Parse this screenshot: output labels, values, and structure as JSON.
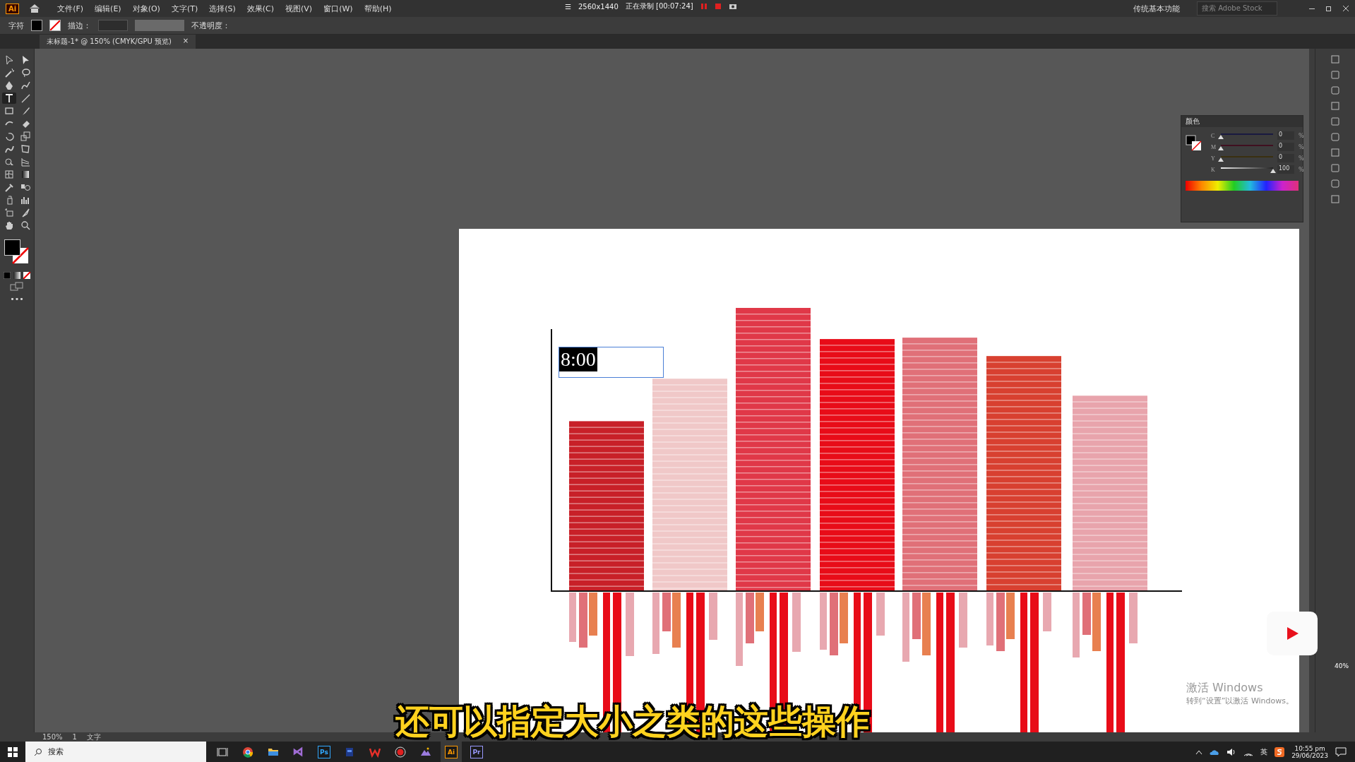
{
  "menu_bar": {
    "app_badge": "Ai",
    "items": [
      "文件(F)",
      "编辑(E)",
      "对象(O)",
      "文字(T)",
      "选择(S)",
      "效果(C)",
      "视图(V)",
      "窗口(W)",
      "帮助(H)"
    ],
    "workspace": "传统基本功能",
    "search": {
      "placeholder": "搜索 Adobe Stock"
    }
  },
  "recorder": {
    "menu": "☰",
    "resolution": "2560x1440",
    "status": "正在录制 [00:07:24]"
  },
  "control_bar": {
    "label": "字符",
    "stroke_label": "描边：",
    "opacity_label": "不透明度："
  },
  "document_tab": {
    "title": "未标题-1* @ 150% (CMYK/GPU 预览)",
    "close": "×"
  },
  "tools": [
    {
      "kind": "select",
      "selected": false
    },
    {
      "kind": "direct",
      "selected": false
    },
    {
      "kind": "wand",
      "selected": false
    },
    {
      "kind": "lasso",
      "selected": false
    },
    {
      "kind": "pen",
      "selected": false
    },
    {
      "kind": "curvature",
      "selected": false
    },
    {
      "kind": "type",
      "selected": true
    },
    {
      "kind": "line",
      "selected": false
    },
    {
      "kind": "rect",
      "selected": false
    },
    {
      "kind": "brush",
      "selected": false
    },
    {
      "kind": "shaper",
      "selected": false
    },
    {
      "kind": "eraser",
      "selected": false
    },
    {
      "kind": "rotate",
      "selected": false
    },
    {
      "kind": "scale",
      "selected": false
    },
    {
      "kind": "warp",
      "selected": false
    },
    {
      "kind": "transform",
      "selected": false
    },
    {
      "kind": "builder",
      "selected": false
    },
    {
      "kind": "perspective",
      "selected": false
    },
    {
      "kind": "mesh",
      "selected": false
    },
    {
      "kind": "gradient",
      "selected": false
    },
    {
      "kind": "eyedropper",
      "selected": false
    },
    {
      "kind": "blend",
      "selected": false
    },
    {
      "kind": "symbol",
      "selected": false
    },
    {
      "kind": "graph",
      "selected": false
    },
    {
      "kind": "artboard",
      "selected": false
    },
    {
      "kind": "slice",
      "selected": false
    },
    {
      "kind": "hand",
      "selected": false
    },
    {
      "kind": "zoom",
      "selected": false
    }
  ],
  "more_tools": "•••",
  "artboard": {
    "text_frame": {
      "text": "8:00",
      "selected": true
    },
    "bars": [
      {
        "color": "#c82028"
      },
      {
        "color": "#f0c8c8"
      },
      {
        "color": "#e03848"
      },
      {
        "color": "#e80c18"
      },
      {
        "color": "#e07078"
      },
      {
        "color": "#d84030"
      },
      {
        "color": "#e8a4ac"
      }
    ]
  },
  "color_panel": {
    "title": "颜色",
    "channels": [
      {
        "name": "C",
        "value": "0",
        "level": 0
      },
      {
        "name": "M",
        "value": "0",
        "level": 0
      },
      {
        "name": "Y",
        "value": "0",
        "level": 0
      },
      {
        "name": "K",
        "value": "100",
        "level": 1
      }
    ],
    "unit": "%"
  },
  "status_bar": {
    "zoom": "150%",
    "page": "1",
    "tool": "文字"
  },
  "taskbar": {
    "search": "搜索",
    "apps": [
      {
        "kind": "taskview",
        "selected": false
      },
      {
        "kind": "chrome",
        "selected": false
      },
      {
        "kind": "folder",
        "selected": false
      },
      {
        "kind": "vs",
        "selected": false
      },
      {
        "kind": "badge",
        "label": "Ps",
        "color": "#31a8ff",
        "selected": false
      },
      {
        "kind": "box",
        "selected": false
      },
      {
        "kind": "wps",
        "selected": false
      },
      {
        "kind": "record",
        "selected": false
      },
      {
        "kind": "mountain",
        "selected": false
      },
      {
        "kind": "badge",
        "label": "Ai",
        "color": "#ff9a00",
        "selected": true
      },
      {
        "kind": "badge",
        "label": "Pr",
        "color": "#9999ff",
        "selected": false
      }
    ],
    "ime": "英",
    "time": "10:55 pm",
    "date": "29/06/2023",
    "net": "40%"
  },
  "activation": {
    "title": "激活 Windows",
    "hint": "转到“设置”以激活 Windows。"
  },
  "subtitle": "还可以指定大小之类的这些操作"
}
